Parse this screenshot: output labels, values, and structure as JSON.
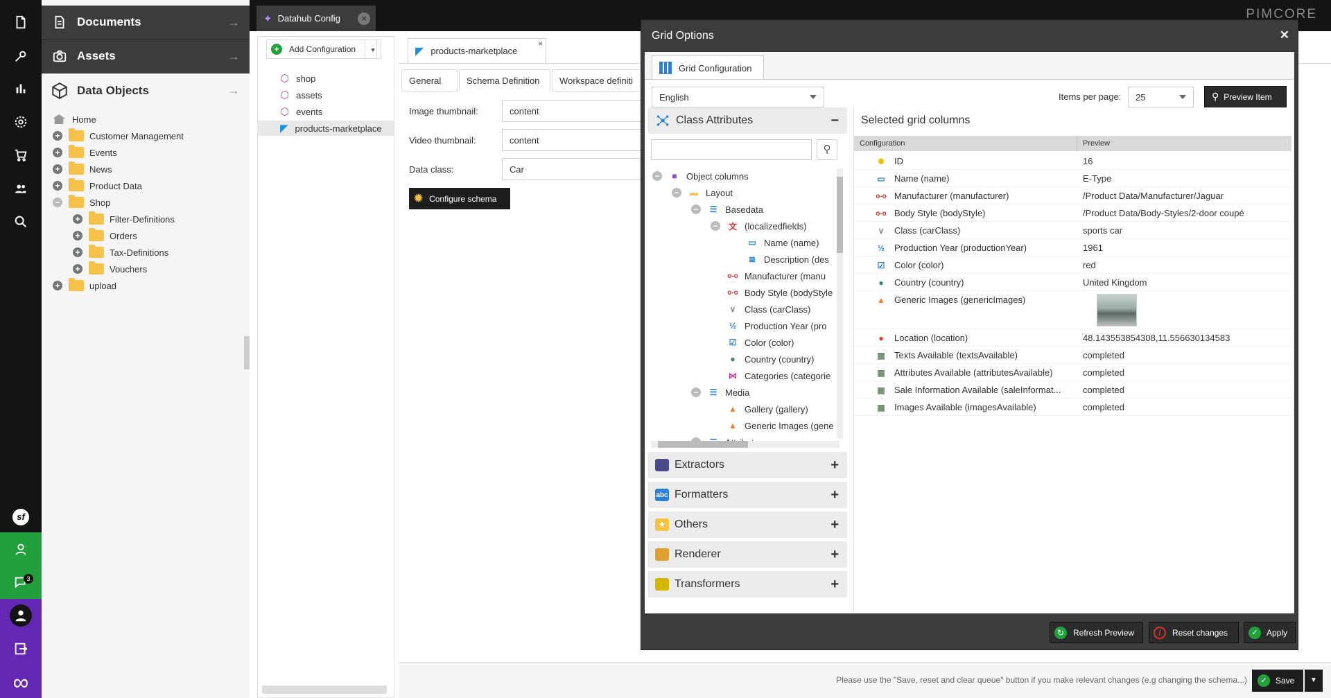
{
  "sidebar": {
    "notification_count": "3"
  },
  "nav": {
    "documents": "Documents",
    "assets": "Assets",
    "data_objects": "Data Objects",
    "tree": [
      {
        "label": "Home",
        "level": 0,
        "toggle": "none",
        "kind": "home"
      },
      {
        "label": "Customer Management",
        "level": 0,
        "toggle": "plus",
        "kind": "folder"
      },
      {
        "label": "Events",
        "level": 0,
        "toggle": "plus",
        "kind": "folder"
      },
      {
        "label": "News",
        "level": 0,
        "toggle": "plus",
        "kind": "folder"
      },
      {
        "label": "Product Data",
        "level": 0,
        "toggle": "plus",
        "kind": "folder"
      },
      {
        "label": "Shop",
        "level": 0,
        "toggle": "minus",
        "kind": "folder"
      },
      {
        "label": "Filter-Definitions",
        "level": 1,
        "toggle": "plus",
        "kind": "folder"
      },
      {
        "label": "Orders",
        "level": 1,
        "toggle": "plus",
        "kind": "folder"
      },
      {
        "label": "Tax-Definitions",
        "level": 1,
        "toggle": "plus",
        "kind": "folder"
      },
      {
        "label": "Vouchers",
        "level": 1,
        "toggle": "plus",
        "kind": "folder"
      },
      {
        "label": "upload",
        "level": 0,
        "toggle": "plus",
        "kind": "folder"
      }
    ]
  },
  "topbar": {
    "tab_label": "Datahub Config",
    "logo": "PIMCORE"
  },
  "config_list": {
    "add_label": "Add Configuration",
    "items": [
      "shop",
      "assets",
      "events",
      "products-marketplace"
    ]
  },
  "editor": {
    "doc_tab": "products-marketplace",
    "subtabs": [
      "General",
      "Schema Definition",
      "Workspace definiti"
    ],
    "image_thumb_label": "Image thumbnail:",
    "image_thumb_value": "content",
    "video_thumb_label": "Video thumbnail:",
    "video_thumb_value": "content",
    "data_class_label": "Data class:",
    "data_class_value": "Car",
    "configure_schema": "Configure schema",
    "footer_hint": "Please use the \"Save, reset and clear queue\" button if you make relevant changes (e.g changing the schema...)",
    "save_label": "Save"
  },
  "modal": {
    "title": "Grid Options",
    "tab": "Grid Configuration",
    "language": "English",
    "items_per_page_label": "Items per page:",
    "items_per_page": "25",
    "preview_item": "Preview Item",
    "class_attributes": "Class Attributes",
    "search_placeholder": "",
    "tree": [
      {
        "label": "Object columns",
        "level": 0,
        "icon": "cube-icon",
        "toggle": "minus"
      },
      {
        "label": "Layout",
        "level": 1,
        "icon": "folder-icon",
        "toggle": "minus"
      },
      {
        "label": "Basedata",
        "level": 2,
        "icon": "panel-icon",
        "toggle": "minus"
      },
      {
        "label": "(localizedfields)",
        "level": 3,
        "icon": "translate-icon",
        "toggle": "minus"
      },
      {
        "label": "Name (name)",
        "level": 4,
        "icon": "input-icon",
        "toggle": "none"
      },
      {
        "label": "Description (des",
        "level": 4,
        "icon": "textarea-icon",
        "toggle": "none"
      },
      {
        "label": "Manufacturer (manu",
        "level": 3,
        "icon": "relation-icon",
        "toggle": "none"
      },
      {
        "label": "Body Style (bodyStyle",
        "level": 3,
        "icon": "relation-icon",
        "toggle": "none"
      },
      {
        "label": "Class (carClass)",
        "level": 3,
        "icon": "select-icon",
        "toggle": "none"
      },
      {
        "label": "Production Year (pro",
        "level": 3,
        "icon": "numeric-icon",
        "toggle": "none"
      },
      {
        "label": "Color (color)",
        "level": 3,
        "icon": "multiselect-icon",
        "toggle": "none"
      },
      {
        "label": "Country (country)",
        "level": 3,
        "icon": "globe-icon",
        "toggle": "none"
      },
      {
        "label": "Categories (categorie",
        "level": 3,
        "icon": "categories-icon",
        "toggle": "none"
      },
      {
        "label": "Media",
        "level": 2,
        "icon": "panel-icon",
        "toggle": "minus"
      },
      {
        "label": "Gallery (gallery)",
        "level": 3,
        "icon": "image-icon",
        "toggle": "none"
      },
      {
        "label": "Generic Images (gene",
        "level": 3,
        "icon": "image-icon",
        "toggle": "none"
      },
      {
        "label": "Attributes",
        "level": 2,
        "icon": "panel-icon",
        "toggle": "minus"
      }
    ],
    "accordions": [
      {
        "label": "Extractors",
        "icon": "extractor-icon",
        "color": "#4a4a8a"
      },
      {
        "label": "Formatters",
        "icon": "abc-icon",
        "color": "#2a7fd6"
      },
      {
        "label": "Others",
        "icon": "star-icon",
        "color": "#f5c242"
      },
      {
        "label": "Renderer",
        "icon": "renderer-icon",
        "color": "#e0a030"
      },
      {
        "label": "Transformers",
        "icon": "transformer-icon",
        "color": "#d4b800"
      }
    ],
    "selected_title": "Selected grid columns",
    "grid_headers": [
      "Configuration",
      "Preview"
    ],
    "grid_rows": [
      {
        "config": "ID",
        "preview": "16",
        "icon": "id-icon"
      },
      {
        "config": "Name (name)",
        "preview": "E-Type",
        "icon": "input-icon"
      },
      {
        "config": "Manufacturer (manufacturer)",
        "preview": "/Product Data/Manufacturer/Jaguar",
        "icon": "relation-icon"
      },
      {
        "config": "Body Style (bodyStyle)",
        "preview": "/Product Data/Body-Styles/2-door coupé",
        "icon": "relation-icon"
      },
      {
        "config": "Class (carClass)",
        "preview": "sports car",
        "icon": "select-icon"
      },
      {
        "config": "Production Year (productionYear)",
        "preview": "1961",
        "icon": "numeric-icon"
      },
      {
        "config": "Color (color)",
        "preview": "red",
        "icon": "multiselect-icon"
      },
      {
        "config": "Country (country)",
        "preview": "United Kingdom",
        "icon": "globe-icon"
      },
      {
        "config": "Generic Images (genericImages)",
        "preview": "",
        "icon": "image-icon"
      },
      {
        "config": "Location (location)",
        "preview": "48.143553854308,11.556630134583",
        "icon": "location-icon"
      },
      {
        "config": "Texts Available (textsAvailable)",
        "preview": "completed",
        "icon": "calculated-icon"
      },
      {
        "config": "Attributes Available (attributesAvailable)",
        "preview": "completed",
        "icon": "calculated-icon"
      },
      {
        "config": "Sale Information Available (saleInformat...",
        "preview": "completed",
        "icon": "calculated-icon"
      },
      {
        "config": "Images Available (imagesAvailable)",
        "preview": "completed",
        "icon": "calculated-icon"
      }
    ],
    "refresh_preview": "Refresh Preview",
    "reset_changes": "Reset changes",
    "apply": "Apply"
  }
}
